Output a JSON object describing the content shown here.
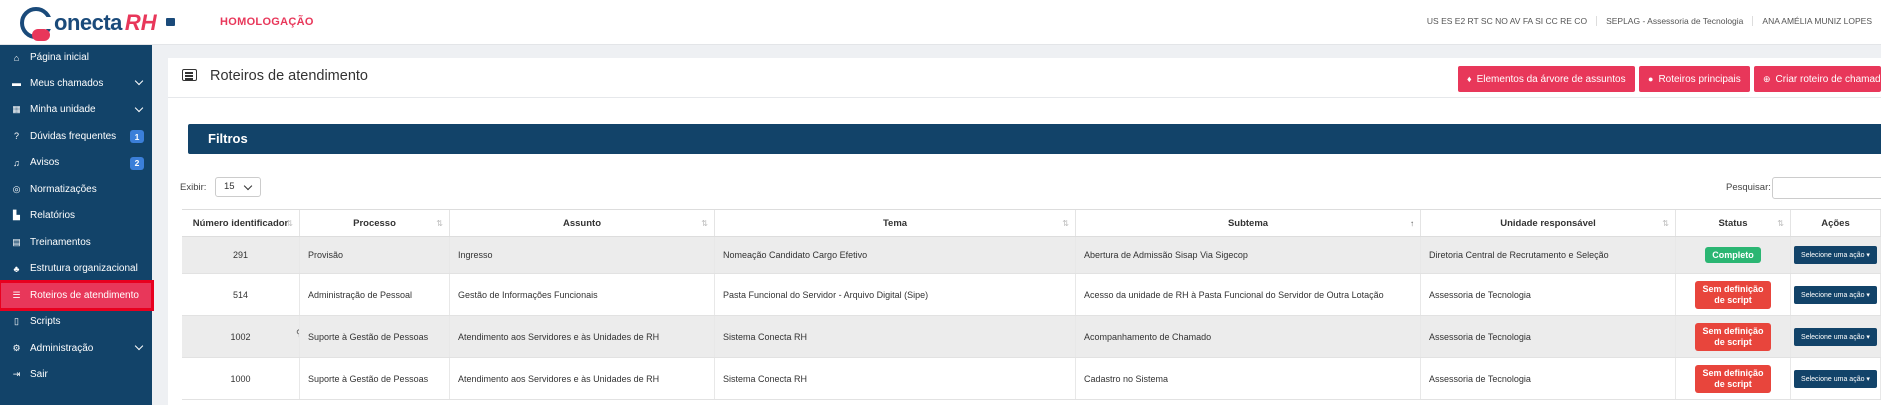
{
  "header": {
    "logo_text": "onecta",
    "logo_rh": "RH",
    "environment": "HOMOLOGAÇÃO",
    "roles": "US ES E2 RT SC NO AV FA SI CC RE CO",
    "unit": "SEPLAG - Assessoria de Tecnologia",
    "user": "ANA AMÉLIA MUNIZ LOPES"
  },
  "sidebar": {
    "items": [
      {
        "label": "Página inicial",
        "icon": "home-icon"
      },
      {
        "label": "Meus chamados",
        "icon": "ticket-icon"
      },
      {
        "label": "Minha unidade",
        "icon": "building-icon"
      },
      {
        "label": "Dúvidas frequentes",
        "icon": "question-icon",
        "badge": "1"
      },
      {
        "label": "Avisos",
        "icon": "bell-icon",
        "badge": "2"
      },
      {
        "label": "Normatizações",
        "icon": "compass-icon"
      },
      {
        "label": "Relatórios",
        "icon": "chart-icon"
      },
      {
        "label": "Treinamentos",
        "icon": "book-icon"
      },
      {
        "label": "Estrutura organizacional",
        "icon": "sitemap-icon"
      },
      {
        "label": "Roteiros de atendimento",
        "icon": "list-icon"
      },
      {
        "label": "Scripts",
        "icon": "file-icon"
      },
      {
        "label": "Administração",
        "icon": "cogs-icon"
      },
      {
        "label": "Sair",
        "icon": "logout-icon"
      }
    ]
  },
  "page": {
    "title": "Roteiros de atendimento",
    "buttons": {
      "tree": "Elementos da árvore de assuntos",
      "main": "Roteiros principais",
      "create": "Criar roteiro de chamad"
    },
    "filters_title": "Filtros",
    "show_label": "Exibir:",
    "show_value": "15",
    "search_label": "Pesquisar:"
  },
  "table": {
    "headers": [
      "Número identificador",
      "Processo",
      "Assunto",
      "Tema",
      "Subtema",
      "Unidade responsável",
      "Status",
      "Ações"
    ],
    "action_label": "Selecione uma ação",
    "rows": [
      {
        "id": "291",
        "processo": "Provisão",
        "assunto": "Ingresso",
        "tema": "Nomeação Candidato Cargo Efetivo",
        "subtema": "Abertura de Admissão Sisap Via Sigecop",
        "unidade": "Diretoria Central de Recrutamento e Seleção",
        "status": "Completo"
      },
      {
        "id": "514",
        "processo": "Administração de Pessoal",
        "assunto": "Gestão de Informações Funcionais",
        "tema": "Pasta Funcional do Servidor - Arquivo Digital (Sipe)",
        "subtema": "Acesso da unidade de RH à Pasta Funcional do Servidor de Outra Lotação",
        "unidade": "Assessoria de Tecnologia",
        "status": "Sem definição de script"
      },
      {
        "id": "1002",
        "processo": "Suporte à Gestão de Pessoas",
        "assunto": "Atendimento aos Servidores e às Unidades de RH",
        "tema": "Sistema Conecta RH",
        "subtema": "Acompanhamento de Chamado",
        "unidade": "Assessoria de Tecnologia",
        "status": "Sem definição de script"
      },
      {
        "id": "1000",
        "processo": "Suporte à Gestão de Pessoas",
        "assunto": "Atendimento aos Servidores e às Unidades de RH",
        "tema": "Sistema Conecta RH",
        "subtema": "Cadastro no Sistema",
        "unidade": "Assessoria de Tecnologia",
        "status": "Sem definição de script"
      }
    ]
  }
}
